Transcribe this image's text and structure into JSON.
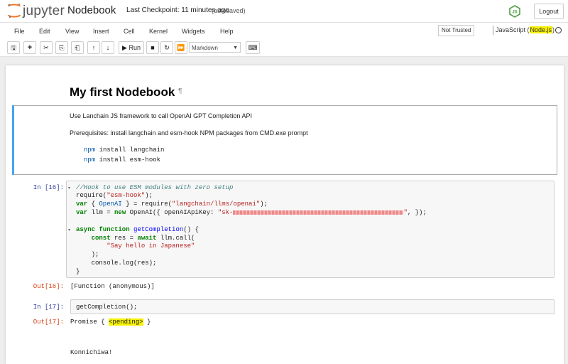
{
  "header": {
    "logo_text": "jupyter",
    "notebook_name": "Nodebook",
    "checkpoint": "Last Checkpoint: 11 minutes ago",
    "autosaved": "(autosaved)",
    "logout_label": "Logout",
    "node_logo": "nodejs-logo-icon"
  },
  "menu": {
    "items": [
      "File",
      "Edit",
      "View",
      "Insert",
      "Cell",
      "Kernel",
      "Widgets",
      "Help"
    ],
    "not_trusted": "Not Trusted",
    "kernel_name": "JavaScript (",
    "kernel_hl": "Node.js",
    "kernel_close": ")"
  },
  "toolbar": {
    "run_label": "Run",
    "cell_type": "Markdown",
    "icons": [
      "save-icon",
      "add-cell-icon",
      "cut-icon",
      "copy-icon",
      "paste-icon",
      "move-up-icon",
      "move-down-icon",
      "run-icon",
      "stop-icon",
      "restart-icon",
      "fast-forward-icon",
      "keyboard-icon"
    ]
  },
  "markdown": {
    "title": "My first Nodebook",
    "anchor": "¶",
    "p1": "Use Lanchain JS framework to call OpenAI GPT Completion API",
    "p2": "Prerequisites: install langchain and esm-hook NPM packages from CMD.exe prompt",
    "npm1_kw": "npm",
    "npm1_rest": " install langchain",
    "npm2_kw": "npm",
    "npm2_rest": " install esm-hook"
  },
  "cell1": {
    "in_prompt": "In [16]:",
    "out_prompt": "Out[16]:",
    "output": "[Function (anonymous)]",
    "l1": "//Hook to use ESM modules with zero setup",
    "l2a": "require(",
    "l2b": "\"esm-hook\"",
    "l2c": ");",
    "l3a": "var",
    "l3b": " { ",
    "l3c": "OpenAI",
    "l3d": " } = require(",
    "l3e": "\"langchain/llms/openai\"",
    "l3f": ");",
    "l4a": "var",
    "l4b": " llm = ",
    "l4c": "new",
    "l4d": " OpenAI({ openAIApiKey: ",
    "l4e": "\"sk-",
    "l4f": "\"",
    "l4g": ", });",
    "l5a": "async function",
    "l5b": " ",
    "l5c": "getCompletion",
    "l5d": "() {",
    "l6a": "    ",
    "l6b": "const",
    "l6c": " res = ",
    "l6d": "await",
    "l6e": " llm.call(",
    "l7a": "        ",
    "l7b": "\"Say hello in Japanese\"",
    "l8": "    );",
    "l9": "    console.log(res);",
    "l10": "}"
  },
  "cell2": {
    "in_prompt": "In [17]:",
    "out_prompt": "Out[17]:",
    "code": "getCompletion();",
    "out_a": "Promise { ",
    "out_hl": "<pending>",
    "out_b": " }",
    "stdout": "Konnichiwa!"
  }
}
